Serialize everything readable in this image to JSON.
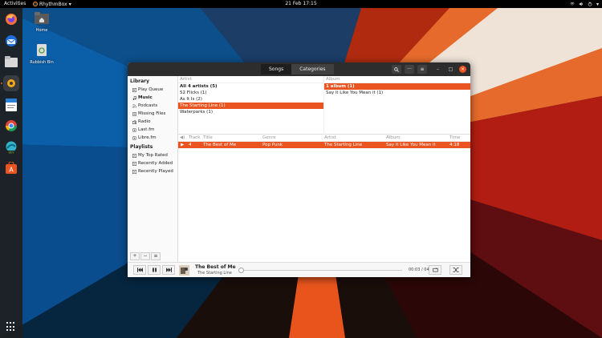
{
  "topbar": {
    "activities": "Activities",
    "app_name": "RhythmBox",
    "clock": "21 Feb  17:15"
  },
  "dock": {
    "apps": [
      "firefox-icon",
      "thunderbird-icon",
      "files-icon",
      "rhythmbox-icon",
      "writer-icon",
      "chrome-icon",
      "edge-dev-icon",
      "software-icon"
    ],
    "show_apps": "app-grid-icon"
  },
  "desktop": {
    "home_label": "Home",
    "trash_label": "Rubbish Bin"
  },
  "window": {
    "tabs": [
      {
        "label": "Songs",
        "active": true
      },
      {
        "label": "Categories",
        "active": false
      }
    ],
    "controls": [
      "search-icon",
      "more-icon",
      "menu-icon",
      "minimize-icon",
      "maximize-icon",
      "close-icon"
    ],
    "accent": "#e95420"
  },
  "sidebar": {
    "library_heading": "Library",
    "library_items": [
      {
        "label": "Play Queue",
        "icon": "queue-icon",
        "bold": false
      },
      {
        "label": "Music",
        "icon": "music-note-icon",
        "bold": true
      },
      {
        "label": "Podcasts",
        "icon": "podcast-icon",
        "bold": false
      },
      {
        "label": "Missing Files",
        "icon": "missing-files-icon",
        "bold": false
      },
      {
        "label": "Radio",
        "icon": "radio-icon",
        "bold": false
      },
      {
        "label": "Last.fm",
        "icon": "lastfm-icon",
        "bold": false
      },
      {
        "label": "Libre.fm",
        "icon": "librefm-icon",
        "bold": false
      }
    ],
    "playlists_heading": "Playlists",
    "playlist_items": [
      {
        "label": "My Top Rated",
        "icon": "smart-playlist-icon"
      },
      {
        "label": "Recently Added",
        "icon": "smart-playlist-icon"
      },
      {
        "label": "Recently Played",
        "icon": "smart-playlist-icon"
      }
    ],
    "tools": [
      "+",
      "−",
      "≡"
    ]
  },
  "browser": {
    "artist_header": "Artist",
    "artists": [
      {
        "label": "All 4 artists (5)",
        "bold": true,
        "selected": false
      },
      {
        "label": "52 Flicks (1)",
        "bold": false,
        "selected": false
      },
      {
        "label": "As It Is (2)",
        "bold": false,
        "selected": false
      },
      {
        "label": "The Starting Line (1)",
        "bold": false,
        "selected": true
      },
      {
        "label": "Waterparks (1)",
        "bold": false,
        "selected": false
      }
    ],
    "album_header": "Album",
    "albums": [
      {
        "label": "1 album (1)",
        "bold": true,
        "selected": true
      },
      {
        "label": "Say it Like You Mean it (1)",
        "bold": false,
        "selected": false
      }
    ]
  },
  "tracklist": {
    "headers": {
      "playing": "◀)",
      "track": "Track",
      "title": "Title",
      "genre": "Genre",
      "artist": "Artist",
      "album": "Album",
      "time": "Time"
    },
    "rows": [
      {
        "playing": "▶",
        "track": "4",
        "title": "The Best of Me",
        "genre": "Pop Punk",
        "artist": "The Starting Line",
        "album": "Say it Like You Mean it",
        "time": "4:18"
      }
    ]
  },
  "player": {
    "title": "The Best of Me",
    "artist": "The Starting Line",
    "time": "00:03 / 04:18",
    "progress": 0.01
  }
}
